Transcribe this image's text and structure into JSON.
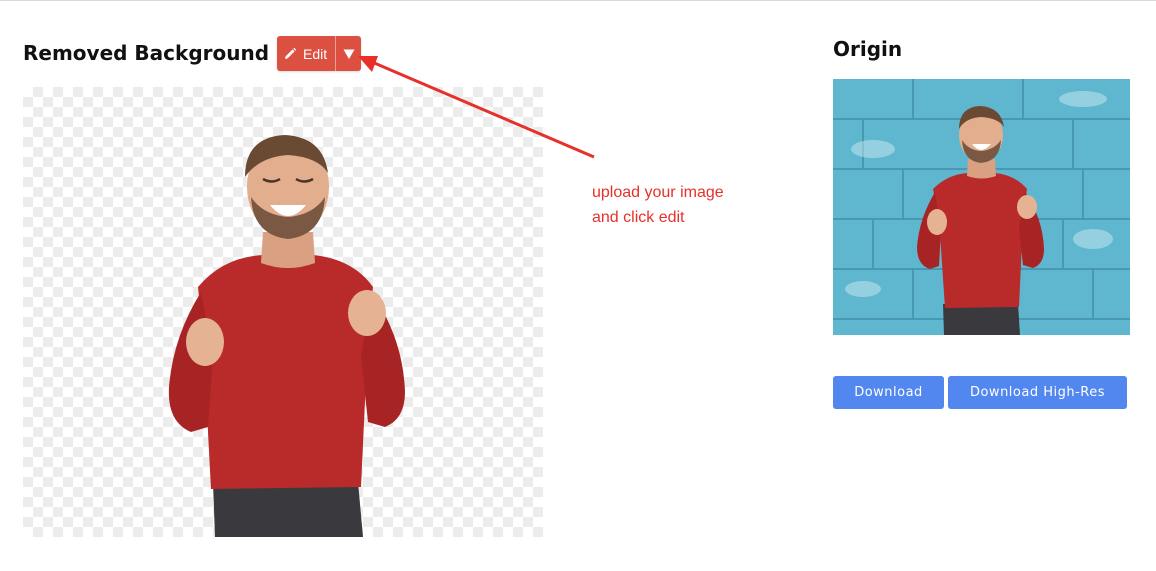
{
  "removed_section": {
    "title": "Removed Background",
    "edit_button": {
      "label": "Edit",
      "icon": "pencil-icon"
    },
    "edit_toggle": {
      "icon": "caret-down-icon"
    },
    "image_alt": "man in red sweater with background removed"
  },
  "origin_section": {
    "title": "Origin",
    "image_alt": "original photo of man in red sweater against blue brick wall"
  },
  "annotation": {
    "line1": "upload your image",
    "line2": "and click edit",
    "color": "#e8302a"
  },
  "actions": {
    "download_label": "Download",
    "download_hires_label": "Download High-Res"
  },
  "colors": {
    "edit_button": "#dc5042",
    "primary_button": "#5187ef",
    "sweater": "#b92a2a",
    "wall": "#5fb6cf"
  }
}
